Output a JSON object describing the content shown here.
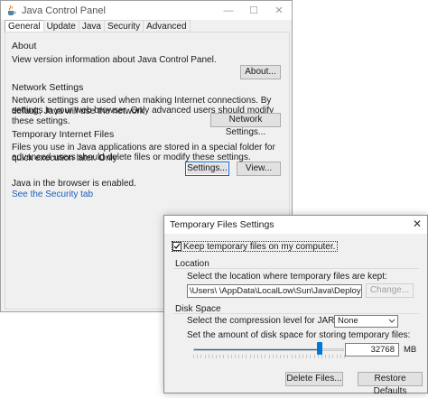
{
  "main_window": {
    "title": "Java Control Panel",
    "controls": {
      "minimize": "—",
      "maximize": "☐",
      "close": "✕"
    },
    "tabs": [
      "General",
      "Update",
      "Java",
      "Security",
      "Advanced"
    ],
    "active_tab": "General",
    "about": {
      "title": "About",
      "text": "View version information about Java Control Panel.",
      "button": "About..."
    },
    "network": {
      "title": "Network Settings",
      "text_line1": "Network settings are used when making Internet connections. By default, Java will use the network",
      "text_line2": "settings in your web browser. Only advanced users should modify these settings.",
      "button": "Network Settings..."
    },
    "temp_files": {
      "title": "Temporary Internet Files",
      "text_line1": "Files you use in Java applications are stored in a special folder for quick execution later. Only",
      "text_line2": "advanced users should delete files or modify these settings.",
      "settings_button": "Settings...",
      "view_button": "View..."
    },
    "browser_status": "Java in the browser is enabled.",
    "security_link": "See the Security tab"
  },
  "dialog": {
    "title": "Temporary Files Settings",
    "close": "✕",
    "keep_checkbox_label": "Keep temporary files on my computer.",
    "keep_checked": true,
    "location": {
      "title": "Location",
      "instruction": "Select the location where temporary files are kept:",
      "path": "\\Users\\        \\AppData\\LocalLow\\Sun\\Java\\Deployment\\cache",
      "change_button": "Change..."
    },
    "disk_space": {
      "title": "Disk Space",
      "compression_label": "Select the compression level for JAR files:",
      "compression_value": "None",
      "amount_label": "Set the amount of disk space for storing temporary files:",
      "amount_value": "32768",
      "unit": "MB",
      "slider_level": 0.84
    },
    "delete_button": "Delete Files...",
    "restore_button": "Restore Defaults"
  },
  "colors": {
    "accent": "#0078d7",
    "link": "#1a5fbf",
    "focus_border": "#0a64c8"
  },
  "icons": [
    "java-coffee-icon",
    "check-icon",
    "chevron-down-icon",
    "close-icon"
  ]
}
